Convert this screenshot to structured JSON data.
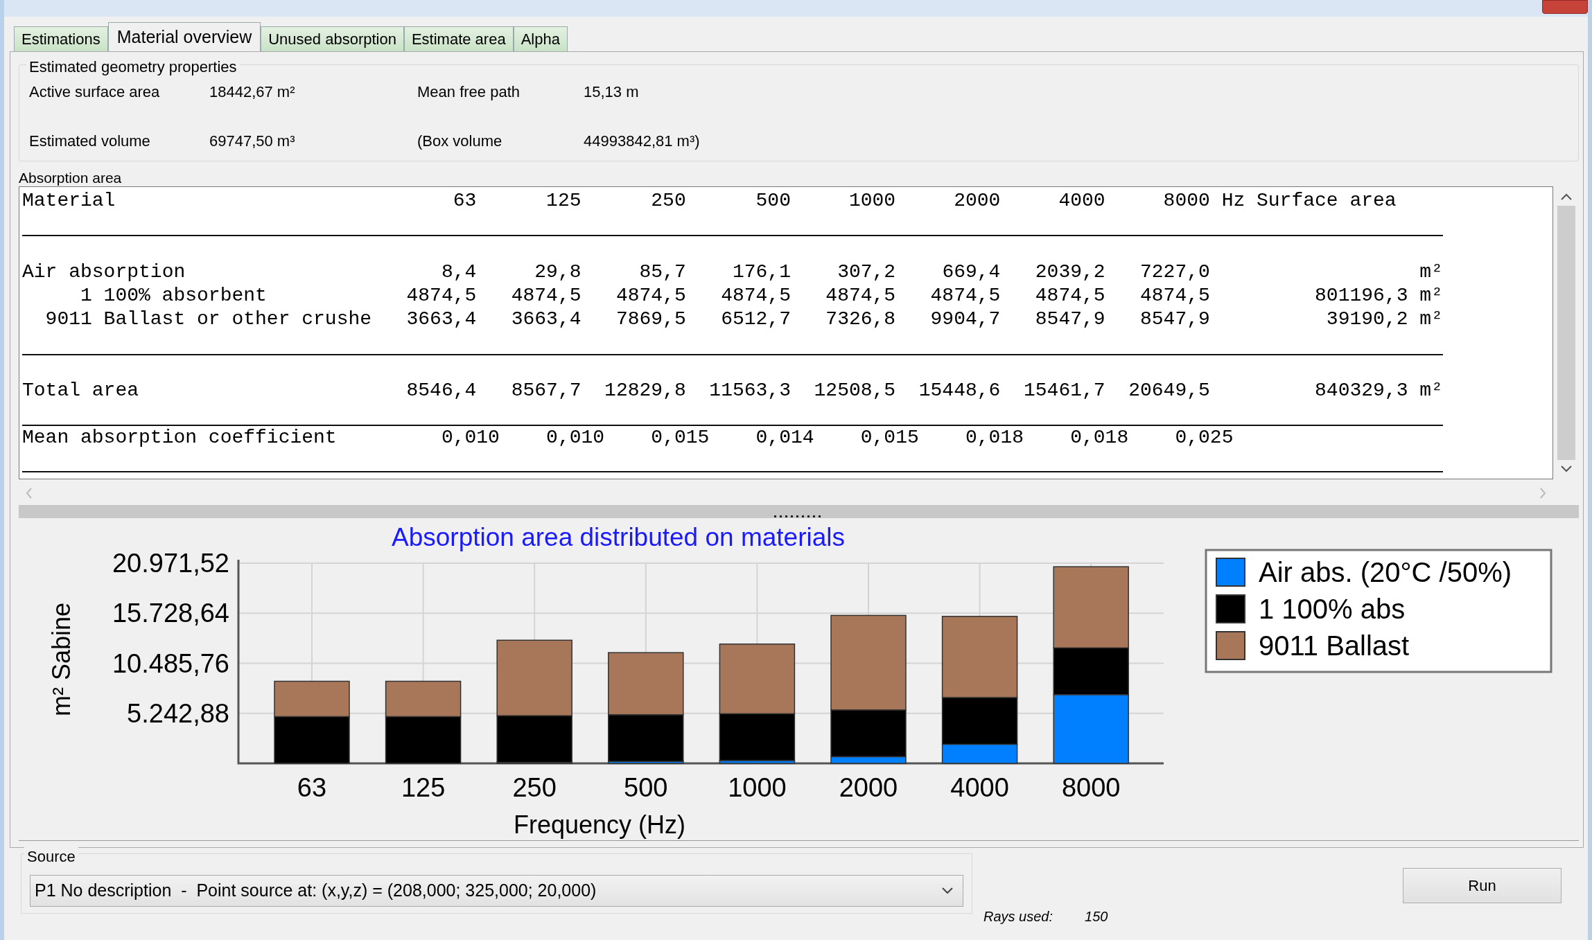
{
  "tabs": [
    {
      "label": "Estimations",
      "selected": false
    },
    {
      "label": "Material overview",
      "selected": true
    },
    {
      "label": "Unused absorption",
      "selected": false
    },
    {
      "label": "Estimate area",
      "selected": false
    },
    {
      "label": "Alpha",
      "selected": false
    }
  ],
  "geometry": {
    "title": "Estimated geometry properties",
    "fields": [
      {
        "label": "Active surface area",
        "value": "18442,67 m²"
      },
      {
        "label": "Mean free path",
        "value": "15,13 m"
      },
      {
        "label": "Estimated volume",
        "value": "69747,50 m³"
      },
      {
        "label": "(Box volume",
        "value": "44993842,81 m³)"
      }
    ]
  },
  "absorption": {
    "title": "Absorption area",
    "header": {
      "material": "Material",
      "bands": [
        "63",
        "125",
        "250",
        "500",
        "1000",
        "2000",
        "4000",
        "8000"
      ],
      "unit": "Hz",
      "surface": "Surface area"
    },
    "rows": [
      {
        "kind": "air",
        "name": "Air absorption",
        "values": [
          "8,4",
          "29,8",
          "85,7",
          "176,1",
          "307,2",
          "669,4",
          "2039,2",
          "7227,0"
        ],
        "unit": "m²"
      },
      {
        "kind": "material",
        "number": "1",
        "name": "100% absorbent",
        "values": [
          "4874,5",
          "4874,5",
          "4874,5",
          "4874,5",
          "4874,5",
          "4874,5",
          "4874,5",
          "4874,5"
        ],
        "surface": "801196,3",
        "unit": "m²"
      },
      {
        "kind": "material",
        "number": "9011",
        "name": "Ballast or other crushe",
        "values": [
          "3663,4",
          "3663,4",
          "7869,5",
          "6512,7",
          "7326,8",
          "9904,7",
          "8547,9",
          "8547,9"
        ],
        "surface": "39190,2",
        "unit": "m²"
      }
    ],
    "total": {
      "label": "Total area",
      "values": [
        "8546,4",
        "8567,7",
        "12829,8",
        "11563,3",
        "12508,5",
        "15448,6",
        "15461,7",
        "20649,5"
      ],
      "surface": "840329,3",
      "unit": "m²"
    },
    "mean": {
      "label": "Mean absorption coefficient",
      "values": [
        "0,010",
        "0,010",
        "0,015",
        "0,014",
        "0,015",
        "0,018",
        "0,018",
        "0,025"
      ]
    }
  },
  "chart_data": {
    "type": "bar",
    "title": "Absorption area distributed on materials",
    "xlabel": "Frequency (Hz)",
    "ylabel": "m² Sabine",
    "stacked": true,
    "categories": [
      "63",
      "125",
      "250",
      "500",
      "1000",
      "2000",
      "4000",
      "8000"
    ],
    "grid": true,
    "legend": true,
    "series": [
      {
        "name": "Air abs. (20°C /50%)",
        "color": "#0080ff",
        "values": [
          0,
          0,
          100,
          200,
          300,
          700,
          2000,
          7200
        ]
      },
      {
        "name": "1 100% abs",
        "color": "#000000",
        "values": [
          4900,
          4900,
          4900,
          4900,
          4900,
          4900,
          4900,
          4900
        ]
      },
      {
        "name": "9011 Ballast",
        "color": "#a8775a",
        "values": [
          3700,
          3700,
          7900,
          6500,
          7300,
          9900,
          8500,
          8500
        ]
      }
    ],
    "ylim": [
      0,
      20971.52
    ],
    "yticks": [
      {
        "value": 5242.88,
        "label": "5.242,88"
      },
      {
        "value": 10485.76,
        "label": "10.485,76"
      },
      {
        "value": 15728.64,
        "label": "15.728,64"
      },
      {
        "value": 20971.52,
        "label": "20.971,52"
      }
    ]
  },
  "source": {
    "title": "Source",
    "value": "P1 No description  -  Point source at: (x,y,z) = (208,000; 325,000; 20,000)"
  },
  "run_button": "Run",
  "rays": {
    "label": "Rays used:",
    "value": "150"
  }
}
